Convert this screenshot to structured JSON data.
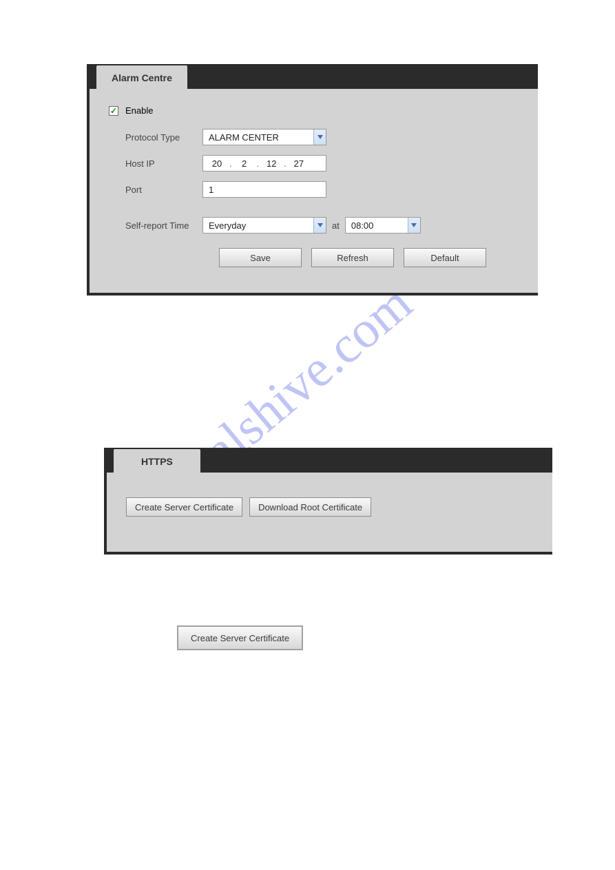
{
  "watermark": "manualshive.com",
  "alarmCentre": {
    "tabLabel": "Alarm Centre",
    "enableLabel": "Enable",
    "enableChecked": true,
    "protocolTypeLabel": "Protocol Type",
    "protocolTypeValue": "ALARM CENTER",
    "hostIpLabel": "Host IP",
    "hostIp": {
      "a": "20",
      "b": "2",
      "c": "12",
      "d": "27"
    },
    "portLabel": "Port",
    "portValue": "1",
    "selfReportLabel": "Self-report Time",
    "selfReportDay": "Everyday",
    "atLabel": "at",
    "selfReportTime": "08:00",
    "buttons": {
      "save": "Save",
      "refresh": "Refresh",
      "default": "Default"
    }
  },
  "https": {
    "tabLabel": "HTTPS",
    "buttons": {
      "createServerCert": "Create Server Certificate",
      "downloadRootCert": "Download Root Certificate"
    }
  },
  "standalone": {
    "createServerCert": "Create Server Certificate"
  }
}
